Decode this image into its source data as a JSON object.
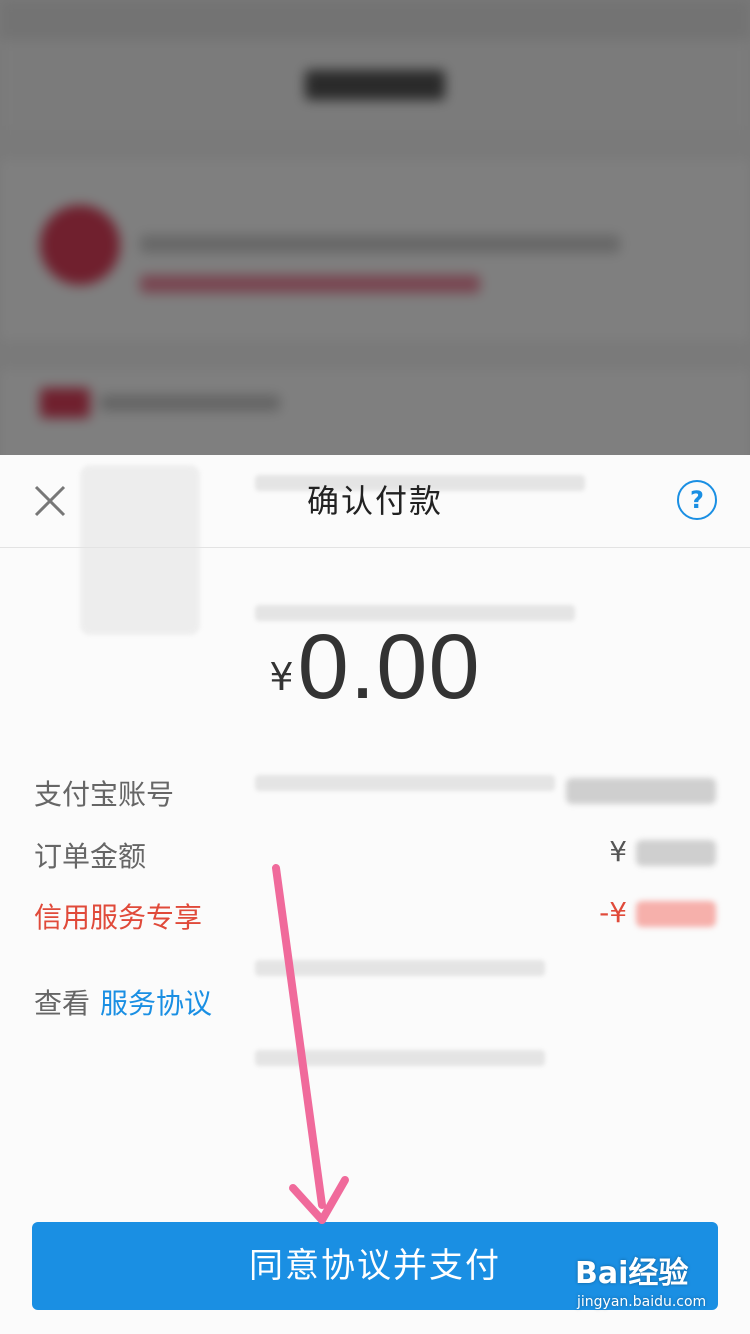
{
  "sheet": {
    "title": "确认付款",
    "help_symbol": "?"
  },
  "amount": {
    "currency": "¥",
    "value": "0.00"
  },
  "rows": {
    "account_label": "支付宝账号",
    "order_amount_label": "订单金额",
    "order_amount_prefix": "¥",
    "credit_label": "信用服务专享",
    "credit_prefix": "-¥"
  },
  "agreement": {
    "view_text": "查看",
    "link_text": "服务协议"
  },
  "pay_button": {
    "label": "同意协议并支付"
  },
  "watermark": {
    "logo": "Bai经验",
    "url": "jingyan.baidu.com"
  },
  "colors": {
    "accent": "#1a8fe3",
    "credit_red": "#e04a3a",
    "arrow_pink": "#f06a9b"
  },
  "icons": {
    "close": "close-icon",
    "help": "help-icon"
  }
}
